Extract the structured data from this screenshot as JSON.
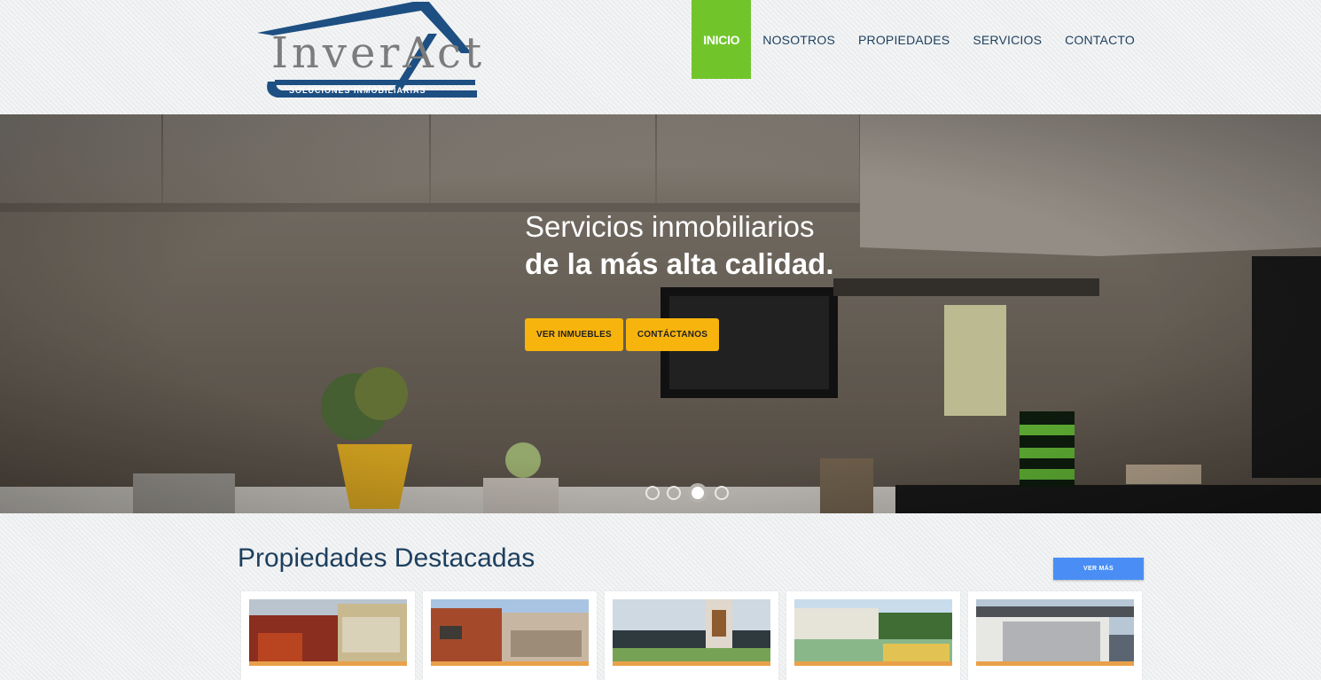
{
  "brand": {
    "name": "InverAct",
    "tagline": "SOLUCIONES INMOBILIARIAS",
    "colors": {
      "blue": "#1d5a8e",
      "gray": "#7c7c7c"
    }
  },
  "nav": {
    "items": [
      {
        "label": "INICIO",
        "active": true
      },
      {
        "label": "NOSOTROS",
        "active": false
      },
      {
        "label": "PROPIEDADES",
        "active": false
      },
      {
        "label": "SERVICIOS",
        "active": false
      },
      {
        "label": "CONTACTO",
        "active": false
      }
    ],
    "active_color": "#71c52a"
  },
  "hero": {
    "title_line1": "Servicios inmobiliarios",
    "title_line2": "de la más alta calidad.",
    "buttons": [
      {
        "label": "VER INMUEBLES"
      },
      {
        "label": "CONTÁCTANOS"
      }
    ],
    "button_color": "#f7b40d",
    "slides": 4,
    "active_slide": 3
  },
  "featured": {
    "title": "Propiedades Destacadas",
    "more_label": "VER MÁS",
    "more_color": "#4a8ef5",
    "properties": [
      {
        "image": "house-photo-1"
      },
      {
        "image": "house-photo-2"
      },
      {
        "image": "house-photo-3"
      },
      {
        "image": "house-photo-4"
      },
      {
        "image": "house-photo-5"
      }
    ]
  }
}
